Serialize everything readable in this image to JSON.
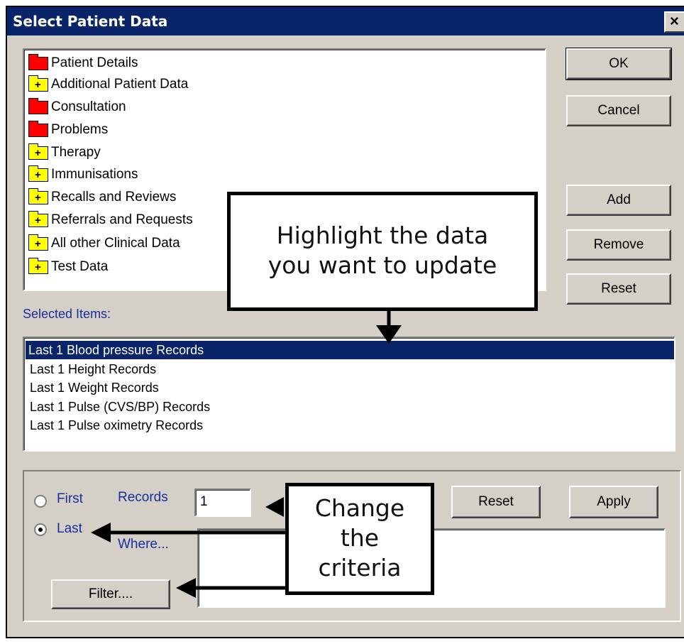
{
  "window": {
    "title": "Select Patient Data",
    "close_label": "×"
  },
  "tree": {
    "items": [
      {
        "label": "Patient Details",
        "folder": "red"
      },
      {
        "label": "Additional Patient Data",
        "folder": "yellow-plus"
      },
      {
        "label": "Consultation",
        "folder": "red"
      },
      {
        "label": "Problems",
        "folder": "red"
      },
      {
        "label": "Therapy",
        "folder": "yellow-plus"
      },
      {
        "label": "Immunisations",
        "folder": "yellow-plus"
      },
      {
        "label": "Recalls and Reviews",
        "folder": "yellow-plus"
      },
      {
        "label": "Referrals and Requests",
        "folder": "yellow-plus"
      },
      {
        "label": "All other Clinical Data",
        "folder": "yellow-plus"
      },
      {
        "label": "Test Data",
        "folder": "yellow-plus"
      }
    ]
  },
  "buttons": {
    "ok": "OK",
    "cancel": "Cancel",
    "add": "Add",
    "remove": "Remove",
    "reset_top": "Reset",
    "reset_bottom": "Reset",
    "apply": "Apply",
    "filter": "Filter...."
  },
  "selected": {
    "label": "Selected Items:",
    "items": [
      "Last 1 Blood pressure Records",
      "Last 1 Height Records",
      "Last 1 Weight Records",
      "Last 1 Pulse (CVS/BP) Records",
      "Last 1 Pulse oximetry Records"
    ],
    "selected_index": 0
  },
  "criteria": {
    "first_label": "First",
    "last_label": "Last",
    "records_label": "Records",
    "records_value": "1",
    "where_label": "Where...",
    "selected_option": "Last"
  },
  "callouts": {
    "highlight_line1": "Highlight the data",
    "highlight_line2": "you want to update",
    "change_line1": "Change",
    "change_line2": "the",
    "change_line3": "criteria"
  },
  "colors": {
    "titlebar": "#0a246a",
    "selection": "#0a246a",
    "label_blue": "#1a2e9c",
    "folder_red": "#ff0000",
    "folder_yellow": "#ffff00"
  }
}
